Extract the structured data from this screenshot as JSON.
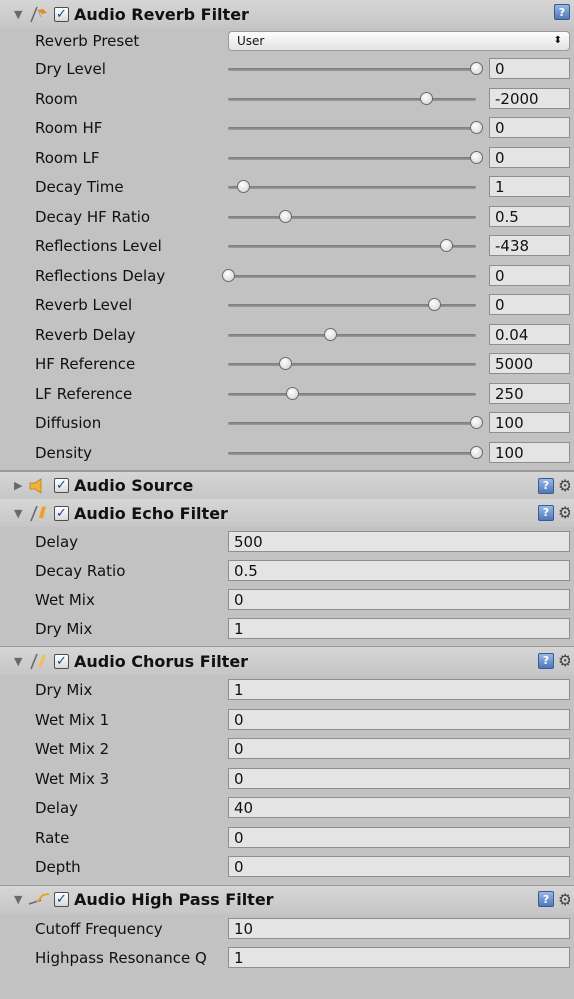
{
  "reverb": {
    "title": "Audio Reverb Filter",
    "enabled": true,
    "preset": {
      "label": "Reverb Preset",
      "value": "User"
    },
    "sliders": [
      {
        "label": "Dry Level",
        "value": "0",
        "pos": 1.0
      },
      {
        "label": "Room",
        "value": "-2000",
        "pos": 0.8
      },
      {
        "label": "Room HF",
        "value": "0",
        "pos": 1.0
      },
      {
        "label": "Room LF",
        "value": "0",
        "pos": 1.0
      },
      {
        "label": "Decay Time",
        "value": "1",
        "pos": 0.06
      },
      {
        "label": "Decay HF Ratio",
        "value": "0.5",
        "pos": 0.23
      },
      {
        "label": "Reflections Level",
        "value": "-438",
        "pos": 0.88
      },
      {
        "label": "Reflections Delay",
        "value": "0",
        "pos": 0.0
      },
      {
        "label": "Reverb Level",
        "value": "0",
        "pos": 0.83
      },
      {
        "label": "Reverb Delay",
        "value": "0.04",
        "pos": 0.41
      },
      {
        "label": "HF Reference",
        "value": "5000",
        "pos": 0.23
      },
      {
        "label": "LF Reference",
        "value": "250",
        "pos": 0.26
      },
      {
        "label": "Diffusion",
        "value": "100",
        "pos": 1.0
      },
      {
        "label": "Density",
        "value": "100",
        "pos": 1.0
      }
    ]
  },
  "source": {
    "title": "Audio Source",
    "enabled": true
  },
  "echo": {
    "title": "Audio Echo Filter",
    "enabled": true,
    "fields": [
      {
        "label": "Delay",
        "value": "500"
      },
      {
        "label": "Decay Ratio",
        "value": "0.5"
      },
      {
        "label": "Wet Mix",
        "value": "0"
      },
      {
        "label": "Dry Mix",
        "value": "1"
      }
    ]
  },
  "chorus": {
    "title": "Audio Chorus Filter",
    "enabled": true,
    "fields": [
      {
        "label": "Dry Mix",
        "value": "1"
      },
      {
        "label": "Wet Mix 1",
        "value": "0"
      },
      {
        "label": "Wet Mix 2",
        "value": "0"
      },
      {
        "label": "Wet Mix 3",
        "value": "0"
      },
      {
        "label": "Delay",
        "value": "40"
      },
      {
        "label": "Rate",
        "value": "0"
      },
      {
        "label": "Depth",
        "value": "0"
      }
    ]
  },
  "highpass": {
    "title": "Audio High Pass Filter",
    "enabled": true,
    "fields": [
      {
        "label": "Cutoff Frequency",
        "value": "10"
      },
      {
        "label": "Highpass Resonance Q",
        "value": "1"
      }
    ]
  },
  "icons": {
    "help": "help-icon",
    "gear": "gear-icon"
  }
}
